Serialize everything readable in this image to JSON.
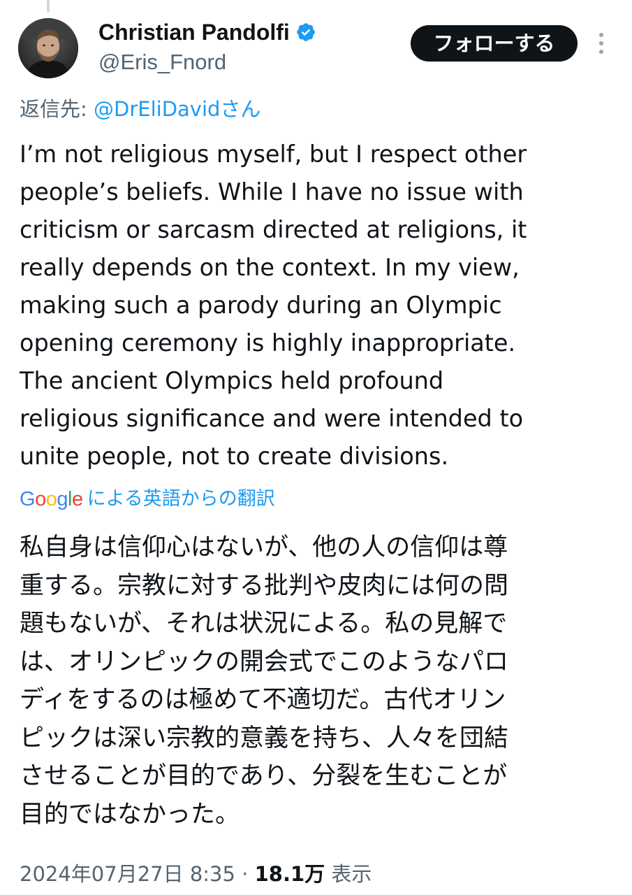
{
  "author": {
    "display_name": "Christian Pandolfi",
    "handle": "@Eris_Fnord",
    "verified_icon": "verified-badge-icon",
    "avatar_icon": "avatar"
  },
  "actions": {
    "follow_label": "フォローする",
    "more_icon": "more-options-icon"
  },
  "reply": {
    "prefix": "返信先:",
    "mention": "@DrEliDavidさん"
  },
  "tweet": {
    "lines": [
      "I’m not religious myself, but I respect other",
      "people’s beliefs. While I have no issue with",
      "criticism or sarcasm directed at religions, it",
      "really depends on the context. In my view,",
      "making such a parody during an Olympic",
      "opening ceremony is highly inappropriate.",
      "The ancient Olympics held profound",
      "religious significance and were intended to",
      "unite people, not to create divisions."
    ]
  },
  "translation": {
    "google_logo": "Google",
    "label": "による英語からの翻訳",
    "lines": [
      "私自身は信仰心はないが、他の人の信仰は尊",
      "重する。宗教に対する批判や皮肉には何の問",
      "題もないが、それは状況による。私の見解で",
      "は、オリンピックの開会式でこのようなパロ",
      "ディをするのは極めて不適切だ。古代オリン",
      "ピックは深い宗教的意義を持ち、人々を団結",
      "させることが目的であり、分裂を生むことが",
      "目的ではなかった。"
    ]
  },
  "meta": {
    "timestamp": "2024年07月27日 8:35",
    "separator": "·",
    "views_count": "18.1万",
    "views_label": "表示"
  },
  "colors": {
    "text": "#0f1419",
    "secondary": "#536471",
    "link": "#1d9bf0",
    "button_bg": "#0f1419",
    "button_text": "#ffffff"
  }
}
